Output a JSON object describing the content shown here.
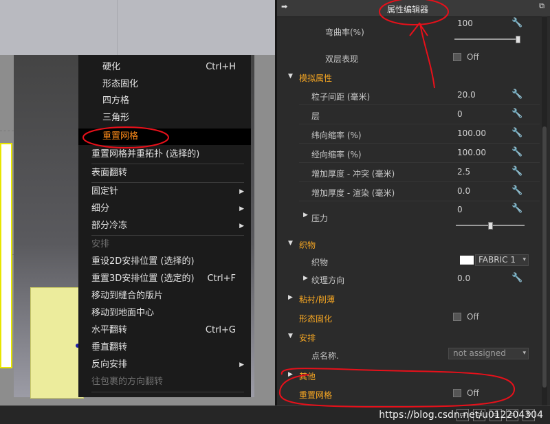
{
  "context_menu": {
    "items": [
      {
        "label": "硬化",
        "shortcut": "Ctrl+H"
      },
      {
        "label": "形态固化"
      },
      {
        "label": "四方格"
      },
      {
        "label": "三角形"
      },
      {
        "label": "重置网格"
      },
      {
        "label": "重置网格并重拓扑 (选择的)"
      },
      {
        "label": "表面翻转"
      },
      {
        "label": "固定针"
      },
      {
        "label": "细分"
      },
      {
        "label": "部分冷冻"
      },
      {
        "label": "安排"
      },
      {
        "label": "重设2D安排位置 (选择的)"
      },
      {
        "label": "重置3D安排位置 (选定的)",
        "shortcut": "Ctrl+F"
      },
      {
        "label": "移动到缝合的版片"
      },
      {
        "label": "移动到地面中心"
      },
      {
        "label": "水平翻转",
        "shortcut": "Ctrl+G"
      },
      {
        "label": "垂直翻转"
      },
      {
        "label": "反向安排"
      },
      {
        "label": "往包裹的方向翻转"
      }
    ]
  },
  "property_editor": {
    "title": "属性编辑器",
    "curvature": {
      "label": "弯曲率(%)",
      "value": "100",
      "slider_fraction": 1.0
    },
    "double_layer": {
      "label": "双层表现",
      "value": "Off"
    },
    "simulation": {
      "title": "模拟属性",
      "particle_distance": {
        "label": "粒子间距 (毫米)",
        "value": "20.0"
      },
      "layer": {
        "label": "层",
        "value": "0"
      },
      "shrink_weft": {
        "label": "纬向缩率 (%)",
        "value": "100.00"
      },
      "shrink_warp": {
        "label": "经向缩率 (%)",
        "value": "100.00"
      },
      "thickness_collision": {
        "label": "增加厚度 - 冲突 (毫米)",
        "value": "2.5"
      },
      "thickness_render": {
        "label": "增加厚度 - 渲染 (毫米)",
        "value": "0.0"
      },
      "pressure": {
        "label": "压力",
        "value": "0",
        "slider_fraction": 0.5
      }
    },
    "fabric": {
      "title": "织物",
      "fabric_label": "织物",
      "fabric_value": "FABRIC 1",
      "grain_label": "纹理方向",
      "grain_value": "0.0"
    },
    "interlining": {
      "title": "粘衬/削薄"
    },
    "solidify": {
      "label": "形态固化",
      "value": "Off"
    },
    "arrangement": {
      "title": "安排",
      "point_name_label": "点名称.",
      "point_name_value": "not assigned"
    },
    "other": {
      "title": "其他"
    },
    "reset_mesh": {
      "label": "重置网格",
      "value": "Off"
    }
  },
  "watermark": "https://blog.csdn.net/u012204304",
  "colors": {
    "section_orange": "#f5a623",
    "menu_highlight": "#ff8c1a",
    "annotation_red": "#e8101a"
  }
}
